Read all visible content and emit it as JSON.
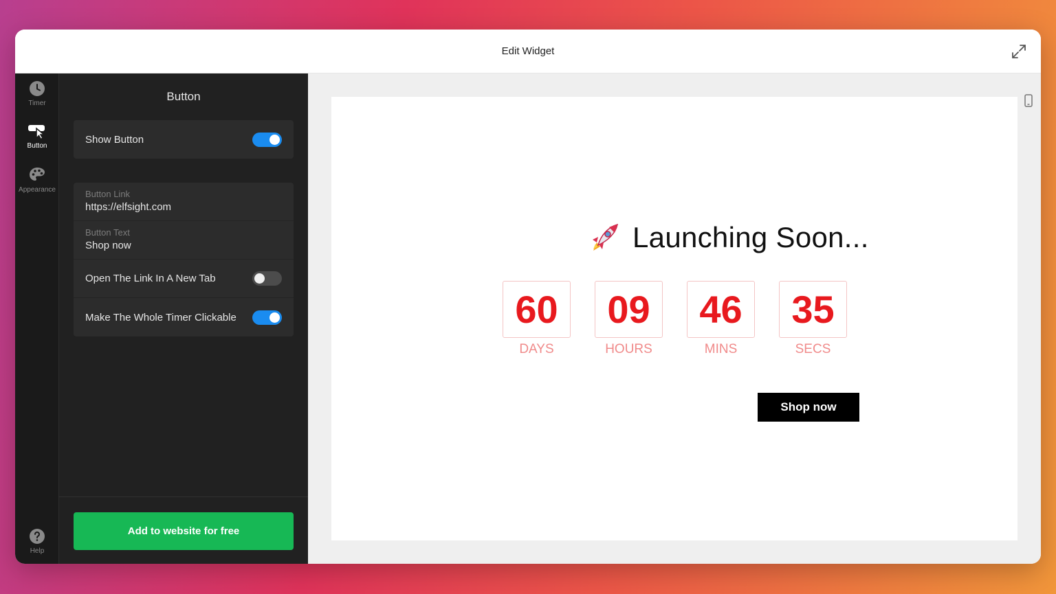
{
  "window": {
    "title": "Edit Widget"
  },
  "rail": {
    "items": [
      {
        "label": "Timer",
        "icon": "clock-icon",
        "active": false
      },
      {
        "label": "Button",
        "icon": "cursor-button-icon",
        "active": true
      },
      {
        "label": "Appearance",
        "icon": "palette-icon",
        "active": false
      }
    ],
    "help": {
      "label": "Help",
      "icon": "help-icon"
    }
  },
  "panel": {
    "title": "Button",
    "show_button": {
      "label": "Show Button",
      "on": true
    },
    "button_link": {
      "label": "Button Link",
      "value": "https://elfsight.com"
    },
    "button_text": {
      "label": "Button Text",
      "value": "Shop now"
    },
    "new_tab": {
      "label": "Open The Link In A New Tab",
      "on": false
    },
    "whole_clickable": {
      "label": "Make The Whole Timer Clickable",
      "on": true
    },
    "cta": "Add to website for free"
  },
  "preview": {
    "headline": "Launching Soon...",
    "units": [
      {
        "value": "60",
        "label": "DAYS"
      },
      {
        "value": "09",
        "label": "HOURS"
      },
      {
        "value": "46",
        "label": "MINS"
      },
      {
        "value": "35",
        "label": "SECS"
      }
    ],
    "button": "Shop now"
  },
  "colors": {
    "toggle_on": "#1a8cf0",
    "cta_green": "#17b855",
    "digit_red": "#e8191e",
    "label_red": "#f08a8a"
  }
}
